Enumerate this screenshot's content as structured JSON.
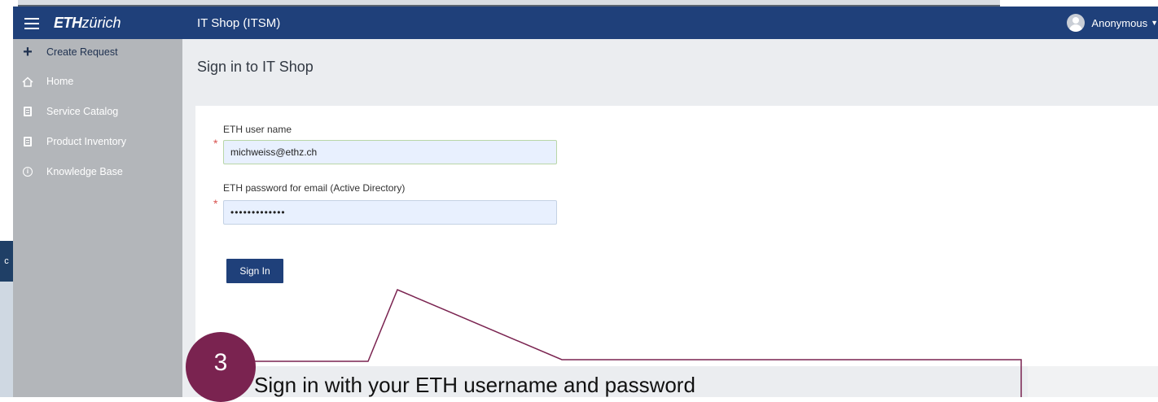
{
  "topbar": {
    "logo_bold": "ETH",
    "logo_light": "zürich",
    "app_title": "IT Shop (ITSM)",
    "user_name": "Anonymous",
    "caret": "▼",
    "menu_icon": "hamburger-icon",
    "avatar_icon": "user-avatar-icon"
  },
  "edge_letter": "c",
  "sidebar": {
    "items": [
      {
        "label": "Create Request",
        "icon": "plus-icon"
      },
      {
        "label": "Home",
        "icon": "home-icon"
      },
      {
        "label": "Service Catalog",
        "icon": "document-icon"
      },
      {
        "label": "Product Inventory",
        "icon": "document-icon"
      },
      {
        "label": "Knowledge Base",
        "icon": "info-icon"
      }
    ]
  },
  "main": {
    "page_title": "Sign in to IT Shop",
    "form": {
      "username_label": "ETH user name",
      "username_value": "michweiss@ethz.ch",
      "password_label": "ETH password for email (Active Directory)",
      "password_value": "•••••••••••••",
      "required_mark": "*",
      "submit_label": "Sign In"
    }
  },
  "annotation": {
    "step_number": "3",
    "text": "Sign in with your ETH username and password"
  },
  "colors": {
    "nav": "#1f407a",
    "sidebar": "#b3b6ba",
    "accent": "#7a2350",
    "required": "#d9534f"
  }
}
